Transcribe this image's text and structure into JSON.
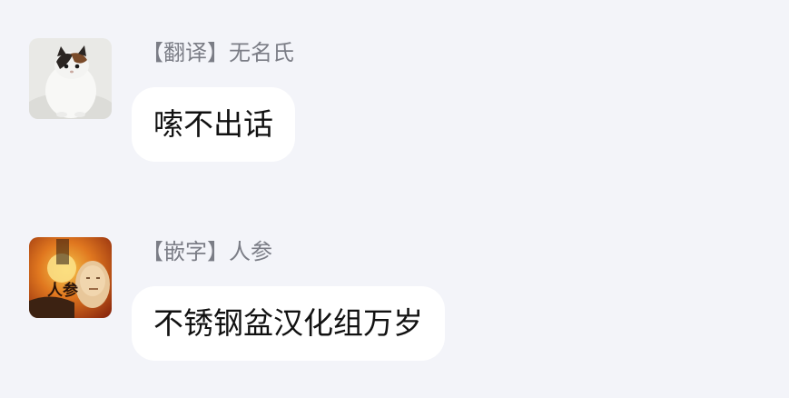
{
  "messages": [
    {
      "avatar_icon": "cat-photo-avatar",
      "sender_tag": "【翻译】",
      "sender_name": "无名氏",
      "text": "嗦不出话"
    },
    {
      "avatar_icon": "ginseng-poster-avatar",
      "sender_tag": "【嵌字】",
      "sender_name": "人参",
      "avatar_caption": "人参",
      "text": "不锈钢盆汉化组万岁"
    }
  ],
  "colors": {
    "background": "#f3f4f9",
    "bubble": "#ffffff",
    "sender_text": "#7b7d86",
    "message_text": "#111111"
  }
}
